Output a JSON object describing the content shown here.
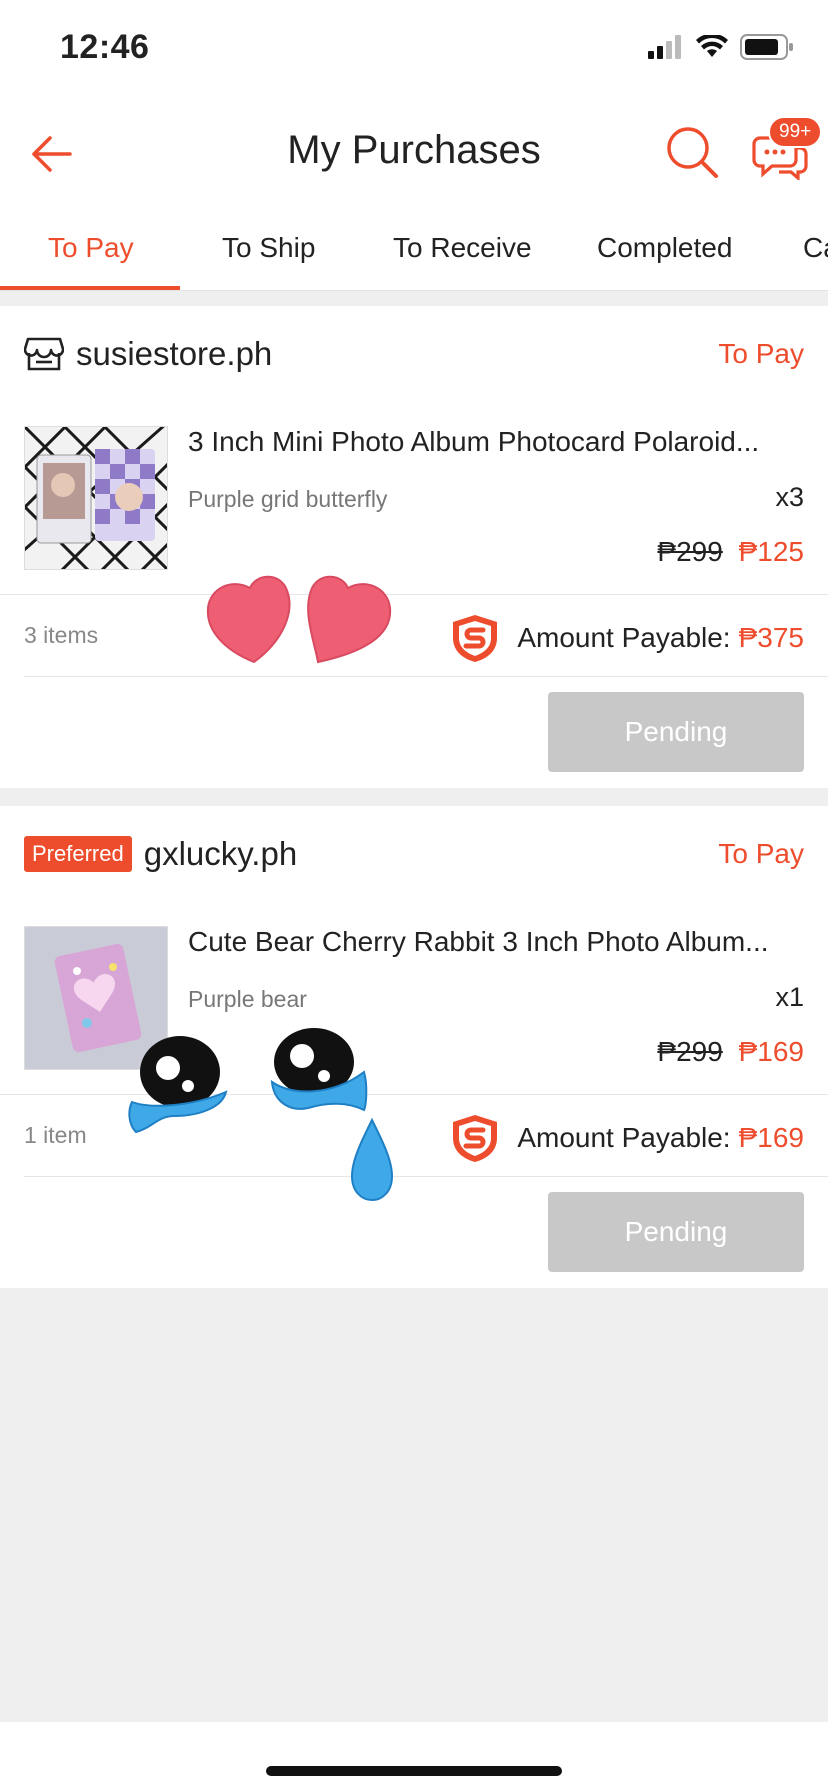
{
  "status_bar": {
    "time": "12:46"
  },
  "header": {
    "title": "My Purchases",
    "chat_badge": "99+"
  },
  "tabs": [
    {
      "label": "To Pay"
    },
    {
      "label": "To Ship"
    },
    {
      "label": "To Receive"
    },
    {
      "label": "Completed"
    },
    {
      "label": "Ca"
    }
  ],
  "orders": [
    {
      "shop_name": "susiestore.ph",
      "status": "To Pay",
      "product_name": "3 Inch Mini Photo Album Photocard Polaroid...",
      "variant": "Purple grid butterfly",
      "quantity": "x3",
      "original_price": "₱299",
      "price": "₱125",
      "items_count": "3 items",
      "amount_label": "Amount Payable:",
      "amount": "₱375",
      "action_label": "Pending"
    },
    {
      "preferred_badge": "Preferred",
      "shop_name": "gxlucky.ph",
      "status": "To Pay",
      "product_name": "Cute Bear Cherry Rabbit 3 Inch Photo Album...",
      "variant": "Purple bear",
      "quantity": "x1",
      "original_price": "₱299",
      "price": "₱169",
      "items_count": "1 item",
      "amount_label": "Amount Payable:",
      "amount": "₱169",
      "action_label": "Pending"
    }
  ],
  "colors": {
    "accent": "#ee4d2d",
    "pending_bg": "#c8c8c8",
    "page_bg": "#efefef"
  }
}
